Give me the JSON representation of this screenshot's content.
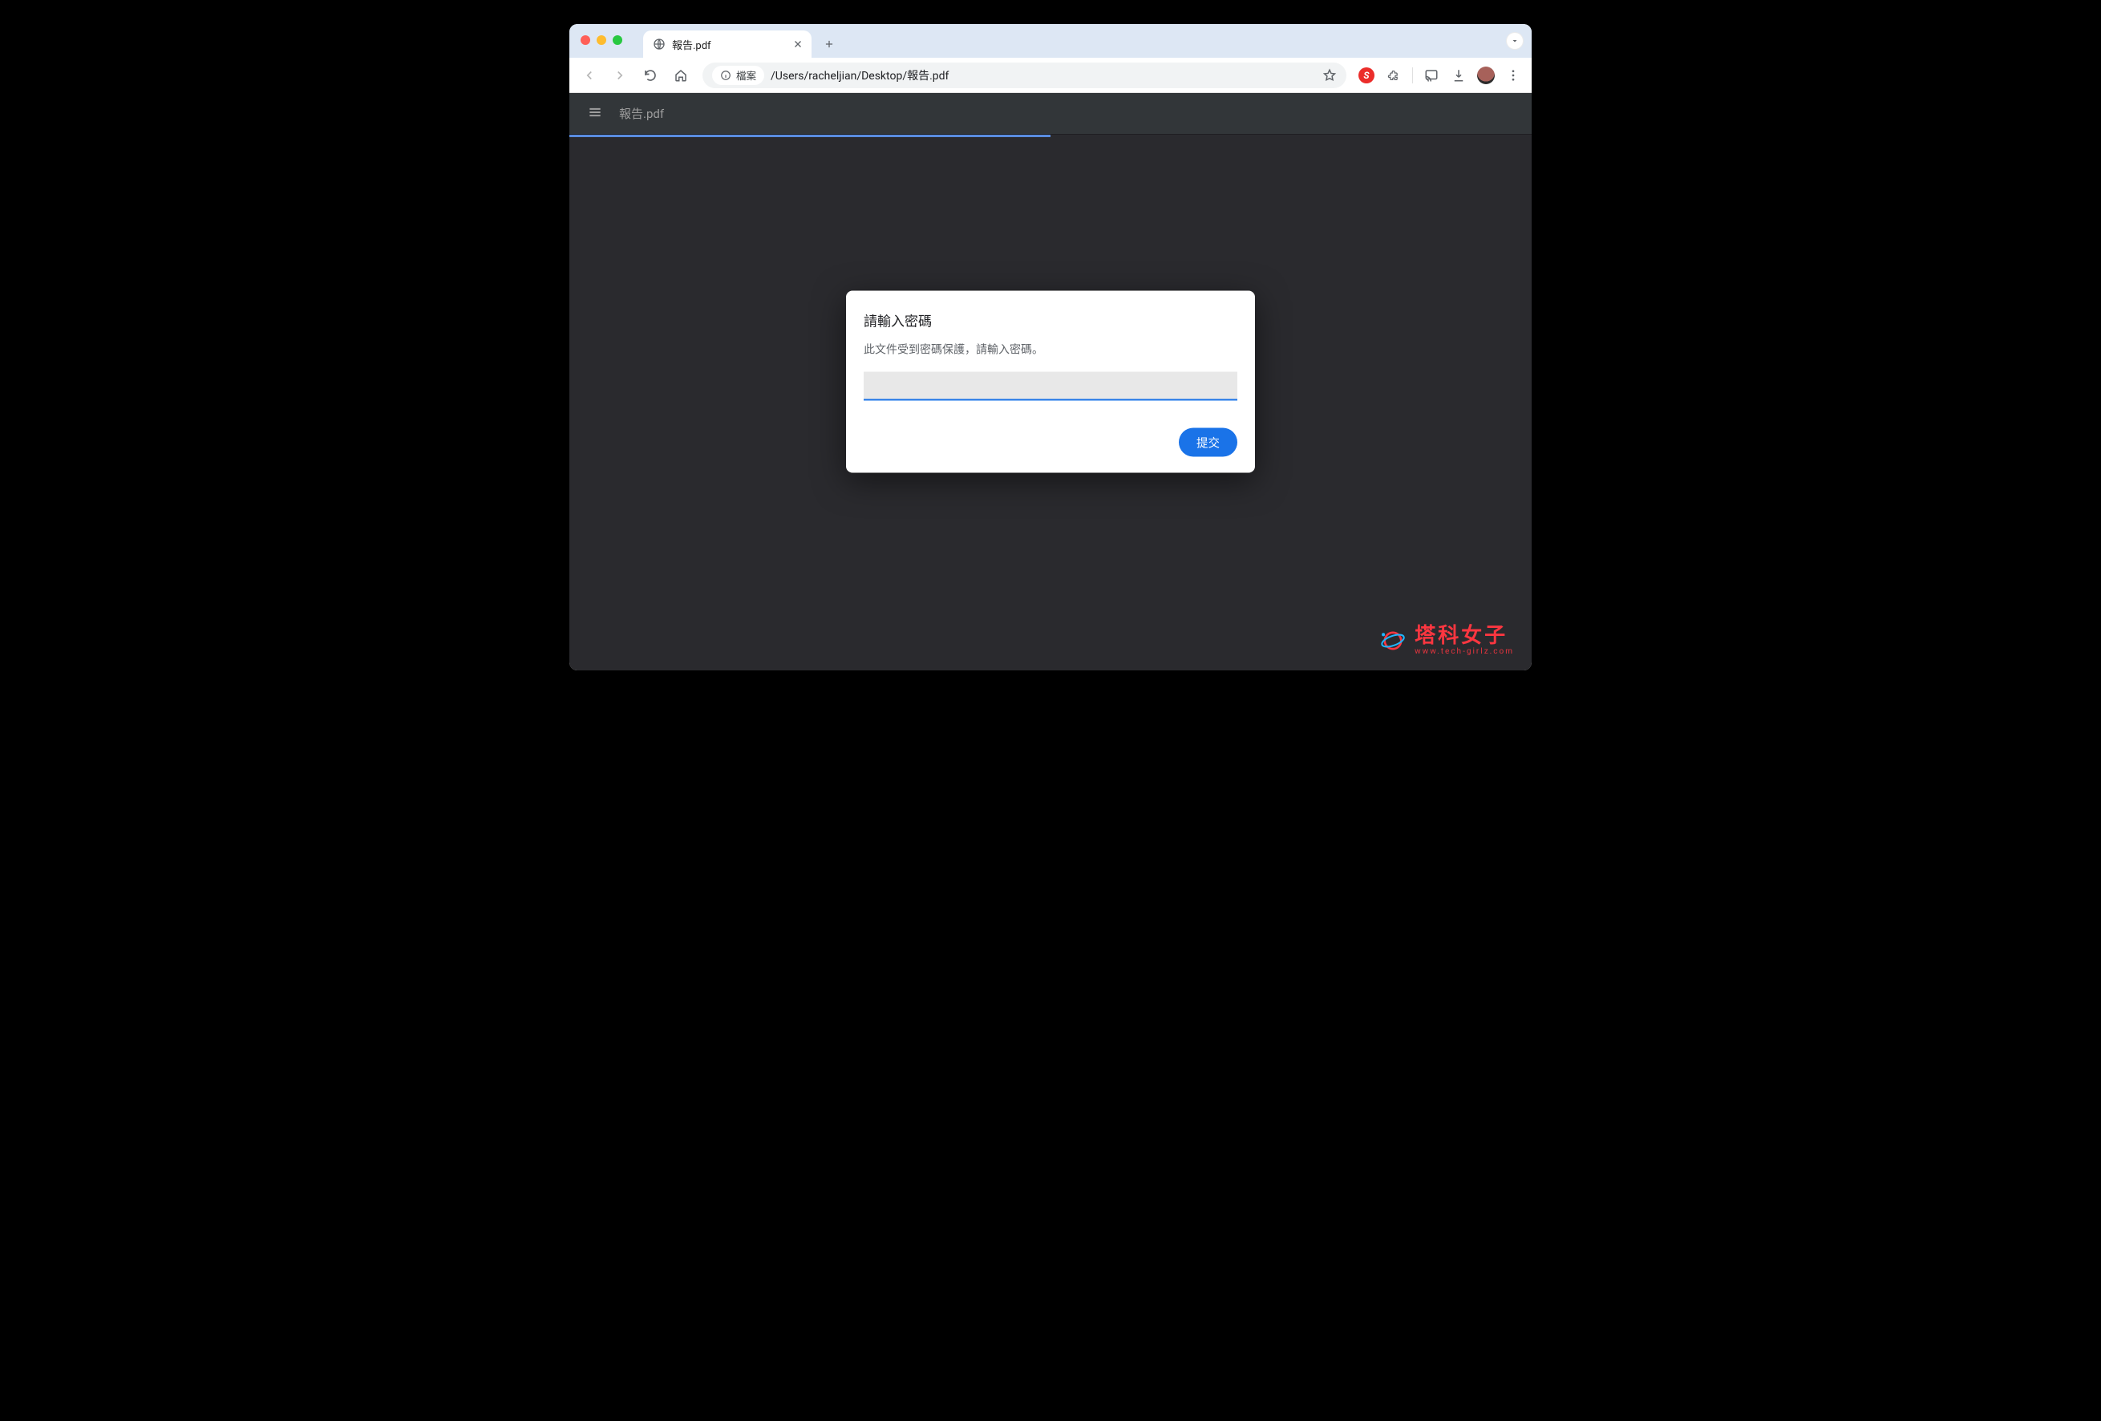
{
  "browser": {
    "tab_title": "報告.pdf",
    "address_chip": "檔案",
    "url_path": "/Users/racheljian/Desktop/報告.pdf"
  },
  "pdf_viewer": {
    "filename": "報告.pdf",
    "dialog": {
      "title": "請輸入密碼",
      "message": "此文件受到密碼保護，請輸入密碼。",
      "submit_label": "提交"
    }
  },
  "watermark": {
    "text_cn": "塔科女子",
    "text_en": "www.tech-girlz.com"
  }
}
